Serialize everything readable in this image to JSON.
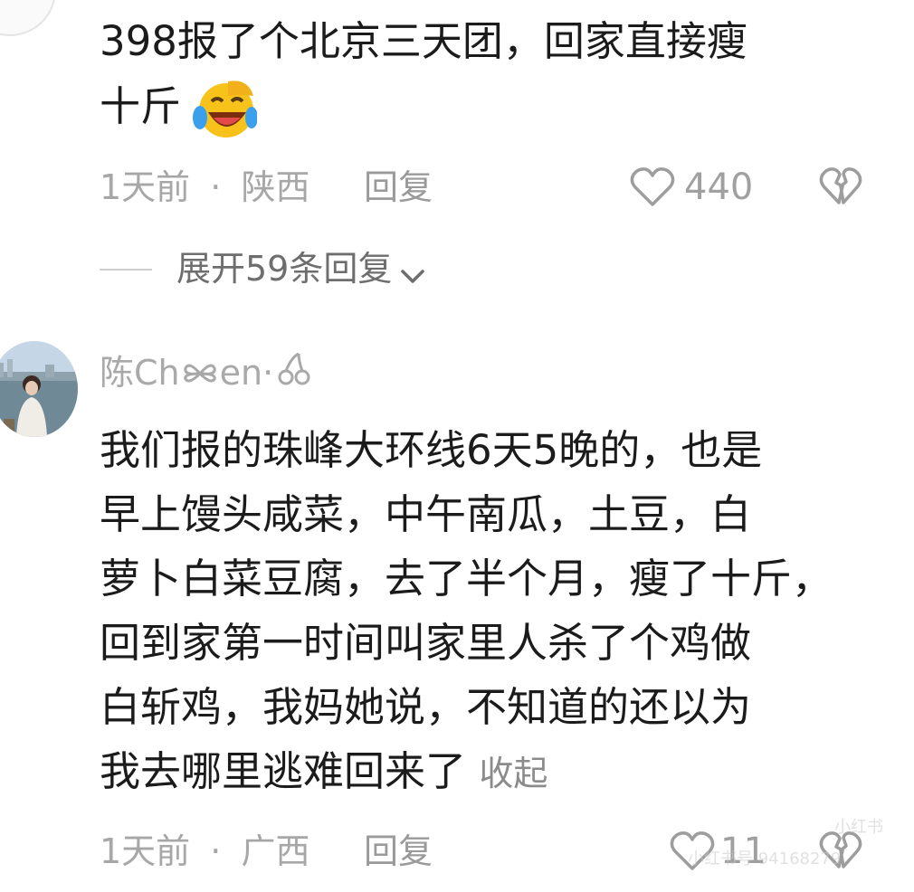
{
  "comment1": {
    "lines": [
      "398报了个北京三天团，回家直接瘦",
      "十斤"
    ],
    "emoji": "face-with-tears-of-joy-icon",
    "time": "1天前",
    "separator": "·",
    "location": "陕西",
    "reply_label": "回复",
    "likes": "440",
    "expand_label": "展开59条回复"
  },
  "comment2": {
    "username": "陈Ch",
    "username_suffix": "en·",
    "lines": [
      "我们报的珠峰大环线6天5晚的，也是",
      "早上馒头咸菜，中午南瓜，土豆，白",
      "萝卜白菜豆腐，去了半个月，瘦了十斤，",
      "回到家第一时间叫家里人杀了个鸡做",
      "白斩鸡，我妈她说，不知道的还以为",
      "我去哪里逃难回来了"
    ],
    "collapse_label": "收起",
    "time": "1天前",
    "separator": "·",
    "location": "广西",
    "reply_label": "回复",
    "likes": "11"
  },
  "watermark": {
    "line1": "小红书",
    "line2": "小红书号 94168279"
  },
  "colors": {
    "main_text": "#1b1b1b",
    "meta_text": "#a7a7a7",
    "background": "#ffffff"
  }
}
